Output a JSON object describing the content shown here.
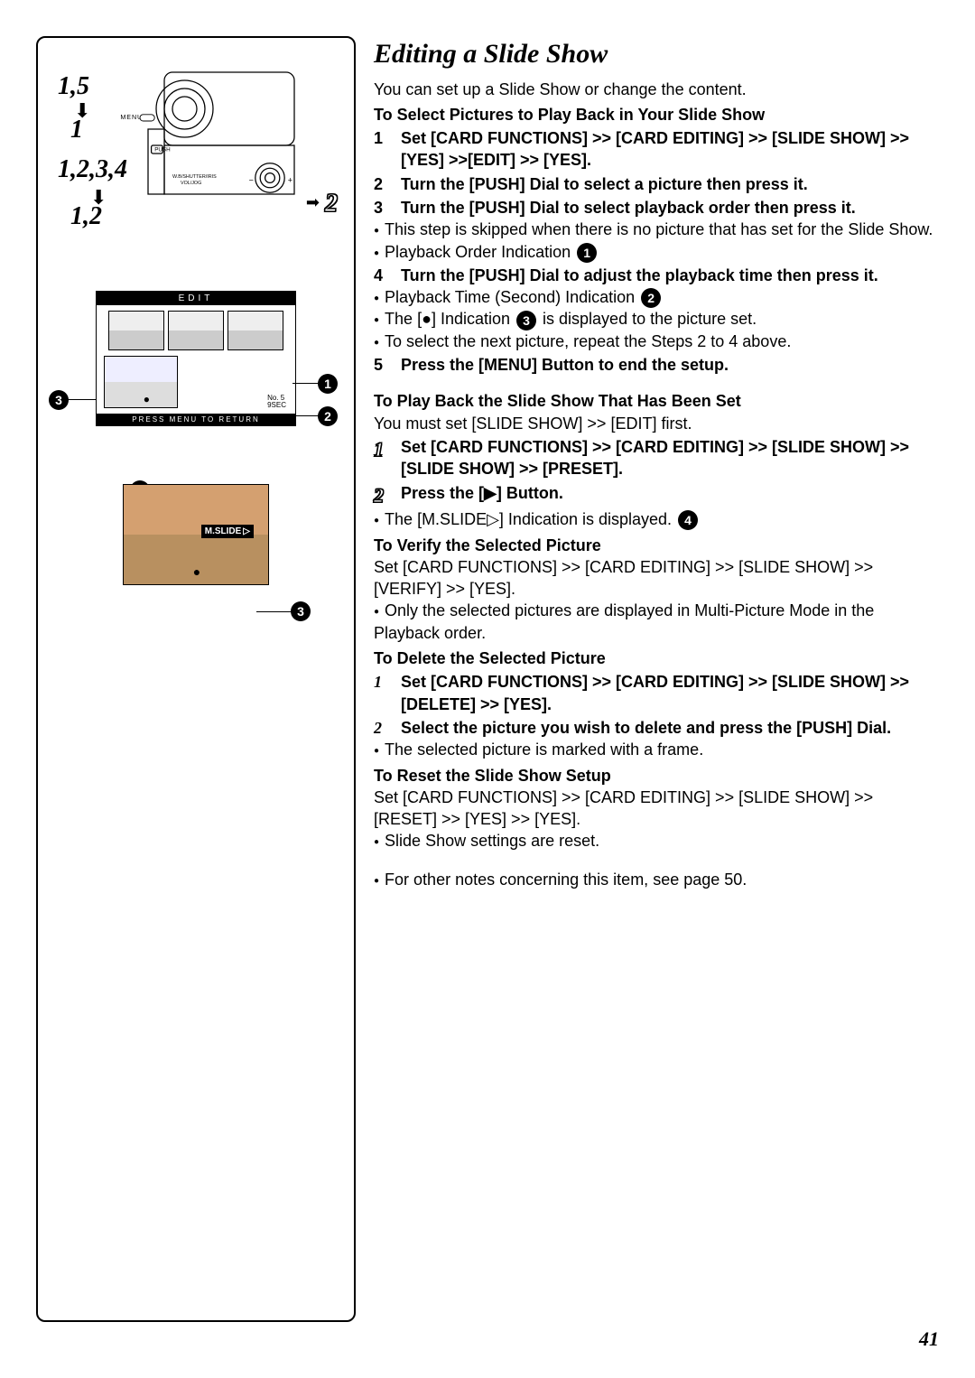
{
  "title": "Editing a Slide Show",
  "intro": "You can set up a Slide Show or change the content.",
  "section_select_heading": "To Select Pictures to Play Back in Your Slide Show",
  "steps_select": {
    "s1": "Set [CARD FUNCTIONS] >> [CARD EDITING] >> [SLIDE SHOW] >> [YES] >>[EDIT] >> [YES].",
    "s2": "Turn the [PUSH] Dial to select a picture then press it.",
    "s3": "Turn the [PUSH] Dial to select playback order then press it.",
    "s3_note1": "This step is skipped when there is no picture that has set for the Slide Show.",
    "s3_note2": "Playback Order Indication",
    "s4": "Turn the [PUSH] Dial to adjust the playback time then press it.",
    "s4_note1": "Playback Time (Second) Indication",
    "s4_note2_a": "The [●] Indication",
    "s4_note2_b": "is displayed to the picture set.",
    "s4_note3": "To select the next picture, repeat the Steps 2 to 4 above.",
    "s5": "Press the [MENU] Button to end the setup."
  },
  "section_playback_heading": "To Play Back the Slide Show That Has Been Set",
  "playback_pre": "You must set [SLIDE SHOW] >> [EDIT] first.",
  "steps_playback": {
    "s1": "Set [CARD FUNCTIONS] >> [CARD EDITING] >> [SLIDE SHOW] >> [SLIDE SHOW] >> [PRESET].",
    "s2": "Press the [▶] Button.",
    "s2_note_a": "The [M.SLIDE▷] Indication is displayed."
  },
  "section_verify_heading": "To Verify the Selected Picture",
  "verify_text": "Set [CARD FUNCTIONS] >> [CARD EDITING] >> [SLIDE SHOW] >> [VERIFY] >> [YES].",
  "verify_note": "Only the selected pictures are displayed in Multi-Picture Mode in the Playback order.",
  "section_delete_heading": "To Delete the Selected Picture",
  "steps_delete": {
    "s1": "Set [CARD FUNCTIONS] >> [CARD EDITING] >> [SLIDE SHOW] >> [DELETE] >> [YES].",
    "s2": "Select the picture you wish to delete and press the [PUSH] Dial.",
    "s2_note": "The selected picture is marked with a frame."
  },
  "section_reset_heading": "To Reset the Slide Show Setup",
  "reset_text": "Set [CARD FUNCTIONS] >> [CARD EDITING] >> [SLIDE SHOW] >> [RESET] >> [YES] >> [YES].",
  "reset_note": "Slide Show settings are reset.",
  "footnote": "For other notes concerning this item, see page 50.",
  "page_number": "41",
  "diagram": {
    "label_1_5": "1,5",
    "label_1": "1",
    "label_1234": "1,2,3,4",
    "label_12": "1,2",
    "outline_2": "2",
    "menu_label": "MENU",
    "push_label": "PUSH",
    "wb_label": "W.B/SHUTTER/IRIS",
    "vol_label": "VOL/JOG",
    "edit_title": "EDIT",
    "edit_footer": "PRESS MENU TO RETURN",
    "no_label": "No. 5",
    "sec_label": "9SEC",
    "mslide": "M.SLIDE"
  }
}
